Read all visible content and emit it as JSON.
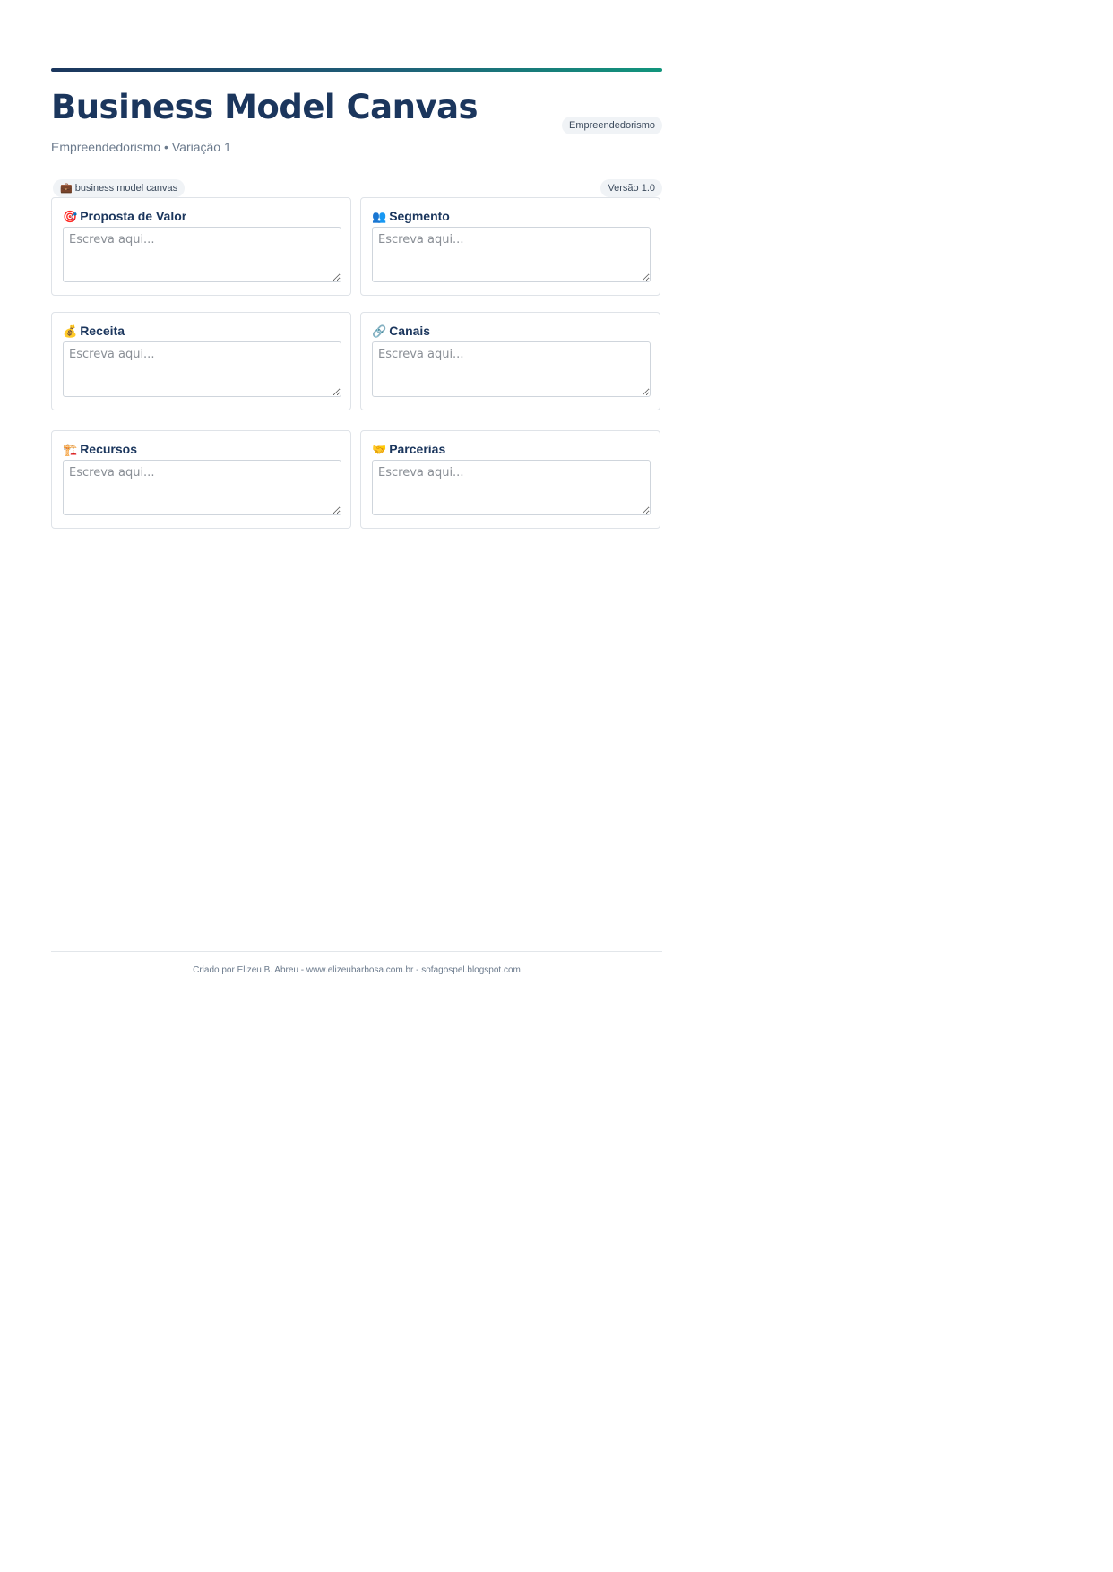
{
  "header": {
    "title": "Business Model Canvas",
    "subtitle": "Empreendedorismo • Variação 1",
    "category_badge": "Empreendedorismo"
  },
  "meta": {
    "tag_icon": "💼",
    "tag_label": "business model canvas",
    "version": "Versão 1.0"
  },
  "cards": [
    {
      "icon": "🎯",
      "icon_name": "target-icon",
      "title": "Proposta de Valor",
      "placeholder": "Escreva aqui...",
      "value": ""
    },
    {
      "icon": "👥",
      "icon_name": "people-icon",
      "title": "Segmento",
      "placeholder": "Escreva aqui...",
      "value": ""
    },
    {
      "icon": "💰",
      "icon_name": "money-bag-icon",
      "title": "Receita",
      "placeholder": "Escreva aqui...",
      "value": ""
    },
    {
      "icon": "🔗",
      "icon_name": "link-icon",
      "title": "Canais",
      "placeholder": "Escreva aqui...",
      "value": ""
    },
    {
      "icon": "🏗️",
      "icon_name": "construction-icon",
      "title": "Recursos",
      "placeholder": "Escreva aqui...",
      "value": ""
    },
    {
      "icon": "🤝",
      "icon_name": "handshake-icon",
      "title": "Parcerias",
      "placeholder": "Escreva aqui...",
      "value": ""
    }
  ],
  "footer": {
    "text": "Criado por Elizeu B. Abreu - www.elizeubarbosa.com.br - sofagospel.blogspot.com"
  },
  "colors": {
    "title": "#1b365d",
    "accent_start": "#1b365d",
    "accent_end": "#12957c"
  }
}
